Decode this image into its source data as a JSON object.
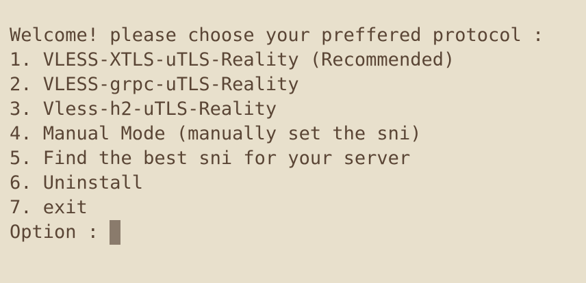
{
  "terminal": {
    "welcome": "Welcome! please choose your preffered protocol :",
    "options": [
      "1. VLESS-XTLS-uTLS-Reality (Recommended)",
      "2. VLESS-grpc-uTLS-Reality",
      "3. Vless-h2-uTLS-Reality",
      "4. Manual Mode (manually set the sni)",
      "5. Find the best sni for your server",
      "6. Uninstall",
      "7. exit"
    ],
    "prompt": "Option : ",
    "input_value": ""
  },
  "colors": {
    "background": "#e8e0cc",
    "text": "#5a4535",
    "cursor": "#8a7b6c"
  }
}
